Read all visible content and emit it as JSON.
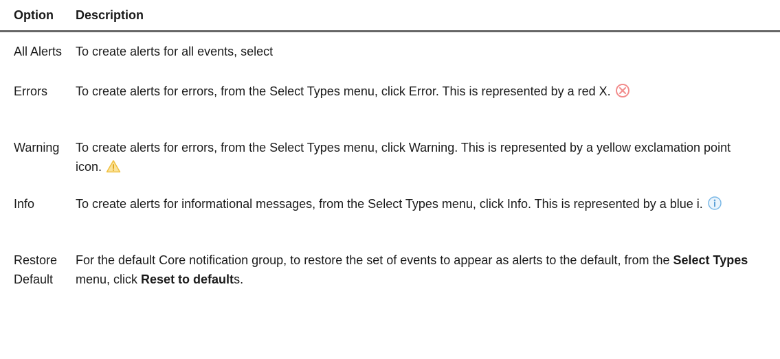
{
  "table": {
    "headers": {
      "option": "Option",
      "description": "Description"
    },
    "rows": [
      {
        "option": "All Alerts",
        "description": "To create alerts for all events, select"
      },
      {
        "option": "Errors",
        "description": "To create alerts for errors, from the Select Types menu, click Error. This is represented by a red X.",
        "icon": "error-icon"
      },
      {
        "option": "Warning",
        "description": "To create alerts for errors, from the Select Types menu, click Warning. This is represented by a yellow exclamation point icon.",
        "icon": "warning-icon"
      },
      {
        "option": "Info",
        "description": "To create alerts for informational messages, from the Select Types menu, click Info. This is represented by a blue i.",
        "icon": "info-icon"
      },
      {
        "option": "Restore Default",
        "description_parts": {
          "part1": "For the default Core notification group, to restore the set of events to appear as alerts to the default, from the ",
          "bold1": "Select Types",
          "part2": " menu, click ",
          "bold2": "Reset to default",
          "part3": "s."
        }
      }
    ]
  },
  "colors": {
    "header_rule": "#666666",
    "error_icon": "#f28c8c",
    "warning_icon": "#f0c040",
    "info_icon": "#7ab8e6"
  }
}
